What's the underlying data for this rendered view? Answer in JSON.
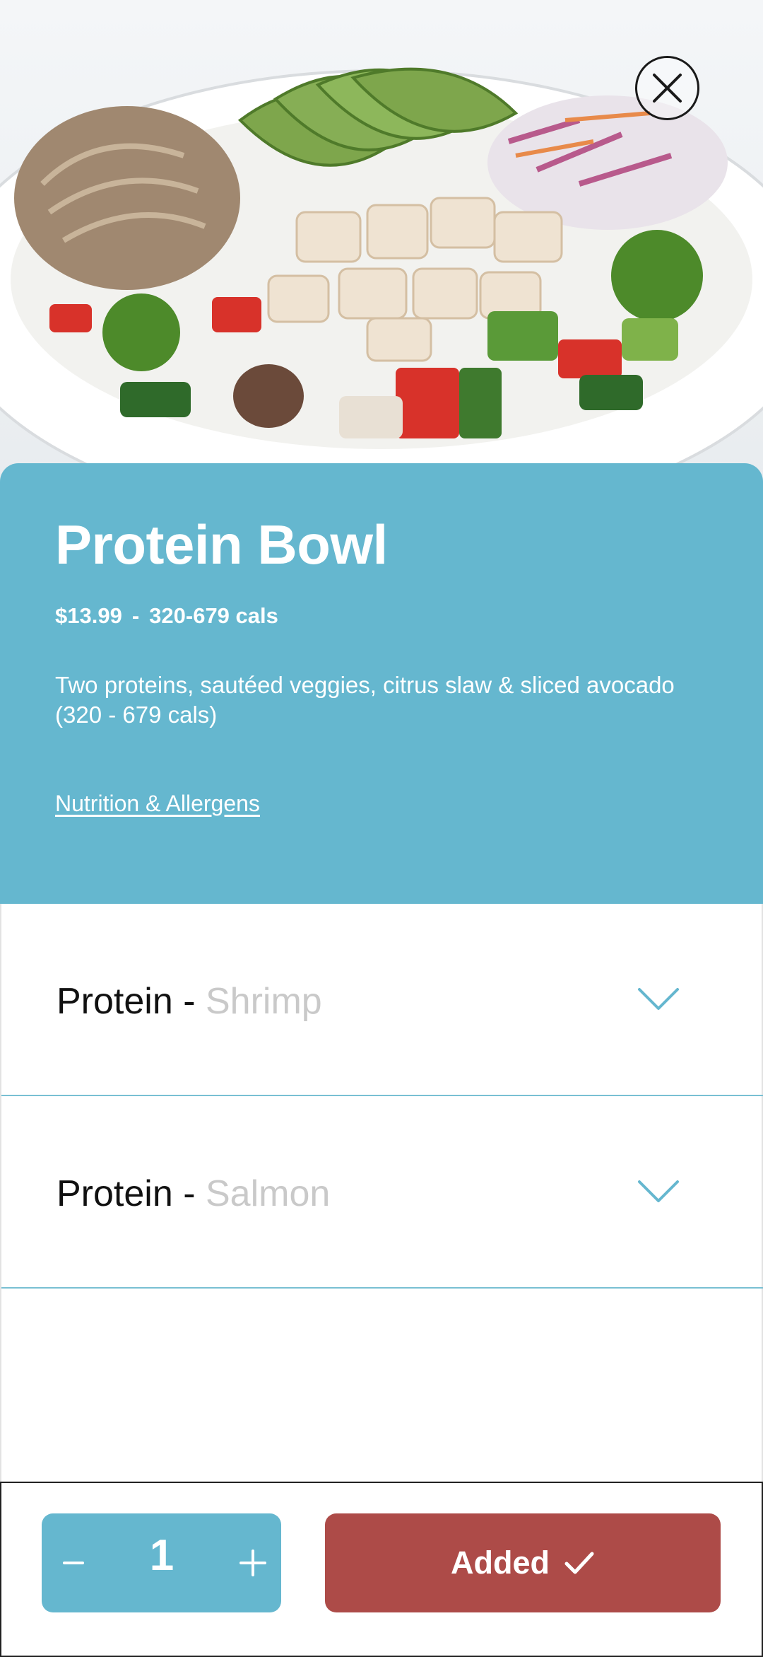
{
  "item": {
    "name": "Protein Bowl",
    "price": "$13.99",
    "separator": "-",
    "calories": "320-679 cals",
    "description": "Two proteins, sautéed veggies, citrus slaw & sliced avocado (320 - 679 cals)",
    "nutrition_link": "Nutrition & Allergens"
  },
  "options": [
    {
      "label": "Protein",
      "dash": " - ",
      "selection": "Shrimp"
    },
    {
      "label": "Protein",
      "dash": " - ",
      "selection": "Salmon"
    }
  ],
  "cart": {
    "quantity": "1",
    "added_label": "Added"
  },
  "icons": {
    "close": "close-icon",
    "chevron": "chevron-down-icon",
    "minus": "minus-icon",
    "plus": "plus-icon",
    "check": "checkmark-icon"
  },
  "colors": {
    "accent_teal": "#65b7cf",
    "added_red": "#ad4b48",
    "placeholder_gray": "#c9c9c9"
  }
}
